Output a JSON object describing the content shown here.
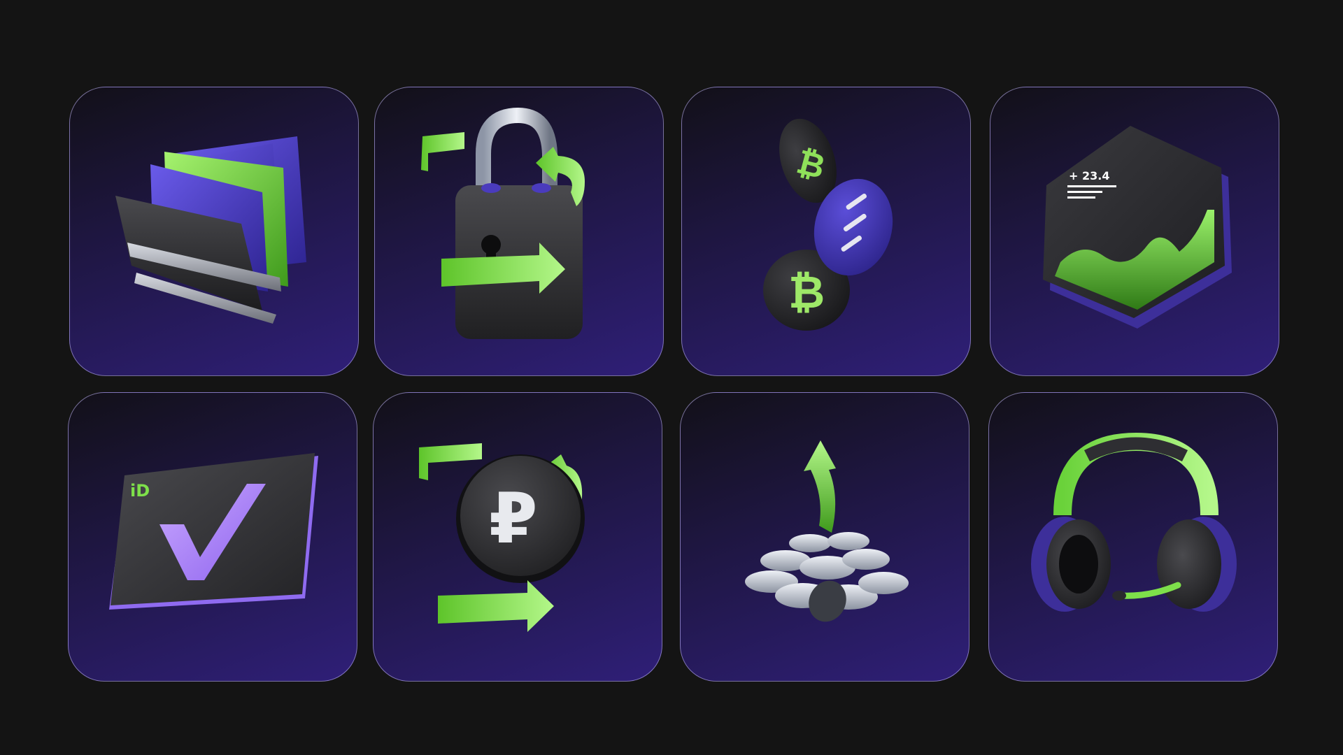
{
  "tiles": [
    {
      "icon": "wallet-cards-icon"
    },
    {
      "icon": "padlock-arrows-icon"
    },
    {
      "icon": "bitcoin-coins-icon"
    },
    {
      "icon": "growth-chart-hexagon-icon",
      "value_label": "+ 23.4"
    },
    {
      "icon": "id-card-check-icon",
      "id_label": "iD"
    },
    {
      "icon": "ruble-exchange-icon",
      "currency_symbol": "₽"
    },
    {
      "icon": "coin-pile-arrow-icon"
    },
    {
      "icon": "headset-icon"
    }
  ],
  "colors": {
    "background": "#141414",
    "tile_dark": "#121018",
    "tile_purple": "#2f1f78",
    "accent_green": "#7ee04a",
    "accent_purple": "#4a3bbd",
    "icon_dark": "#2e2e30"
  }
}
